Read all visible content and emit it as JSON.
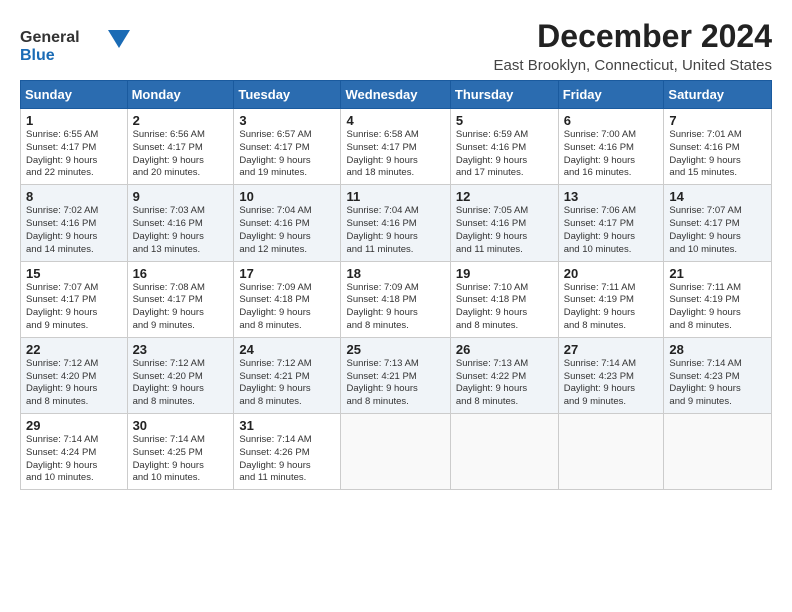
{
  "logo": {
    "line1": "General",
    "line2": "Blue"
  },
  "title": "December 2024",
  "subtitle": "East Brooklyn, Connecticut, United States",
  "header": {
    "colors": {
      "bg": "#2b6cb0"
    }
  },
  "weekdays": [
    "Sunday",
    "Monday",
    "Tuesday",
    "Wednesday",
    "Thursday",
    "Friday",
    "Saturday"
  ],
  "weeks": [
    [
      {
        "day": "1",
        "info": "Sunrise: 6:55 AM\nSunset: 4:17 PM\nDaylight: 9 hours\nand 22 minutes."
      },
      {
        "day": "2",
        "info": "Sunrise: 6:56 AM\nSunset: 4:17 PM\nDaylight: 9 hours\nand 20 minutes."
      },
      {
        "day": "3",
        "info": "Sunrise: 6:57 AM\nSunset: 4:17 PM\nDaylight: 9 hours\nand 19 minutes."
      },
      {
        "day": "4",
        "info": "Sunrise: 6:58 AM\nSunset: 4:17 PM\nDaylight: 9 hours\nand 18 minutes."
      },
      {
        "day": "5",
        "info": "Sunrise: 6:59 AM\nSunset: 4:16 PM\nDaylight: 9 hours\nand 17 minutes."
      },
      {
        "day": "6",
        "info": "Sunrise: 7:00 AM\nSunset: 4:16 PM\nDaylight: 9 hours\nand 16 minutes."
      },
      {
        "day": "7",
        "info": "Sunrise: 7:01 AM\nSunset: 4:16 PM\nDaylight: 9 hours\nand 15 minutes."
      }
    ],
    [
      {
        "day": "8",
        "info": "Sunrise: 7:02 AM\nSunset: 4:16 PM\nDaylight: 9 hours\nand 14 minutes."
      },
      {
        "day": "9",
        "info": "Sunrise: 7:03 AM\nSunset: 4:16 PM\nDaylight: 9 hours\nand 13 minutes."
      },
      {
        "day": "10",
        "info": "Sunrise: 7:04 AM\nSunset: 4:16 PM\nDaylight: 9 hours\nand 12 minutes."
      },
      {
        "day": "11",
        "info": "Sunrise: 7:04 AM\nSunset: 4:16 PM\nDaylight: 9 hours\nand 11 minutes."
      },
      {
        "day": "12",
        "info": "Sunrise: 7:05 AM\nSunset: 4:16 PM\nDaylight: 9 hours\nand 11 minutes."
      },
      {
        "day": "13",
        "info": "Sunrise: 7:06 AM\nSunset: 4:17 PM\nDaylight: 9 hours\nand 10 minutes."
      },
      {
        "day": "14",
        "info": "Sunrise: 7:07 AM\nSunset: 4:17 PM\nDaylight: 9 hours\nand 10 minutes."
      }
    ],
    [
      {
        "day": "15",
        "info": "Sunrise: 7:07 AM\nSunset: 4:17 PM\nDaylight: 9 hours\nand 9 minutes."
      },
      {
        "day": "16",
        "info": "Sunrise: 7:08 AM\nSunset: 4:17 PM\nDaylight: 9 hours\nand 9 minutes."
      },
      {
        "day": "17",
        "info": "Sunrise: 7:09 AM\nSunset: 4:18 PM\nDaylight: 9 hours\nand 8 minutes."
      },
      {
        "day": "18",
        "info": "Sunrise: 7:09 AM\nSunset: 4:18 PM\nDaylight: 9 hours\nand 8 minutes."
      },
      {
        "day": "19",
        "info": "Sunrise: 7:10 AM\nSunset: 4:18 PM\nDaylight: 9 hours\nand 8 minutes."
      },
      {
        "day": "20",
        "info": "Sunrise: 7:11 AM\nSunset: 4:19 PM\nDaylight: 9 hours\nand 8 minutes."
      },
      {
        "day": "21",
        "info": "Sunrise: 7:11 AM\nSunset: 4:19 PM\nDaylight: 9 hours\nand 8 minutes."
      }
    ],
    [
      {
        "day": "22",
        "info": "Sunrise: 7:12 AM\nSunset: 4:20 PM\nDaylight: 9 hours\nand 8 minutes."
      },
      {
        "day": "23",
        "info": "Sunrise: 7:12 AM\nSunset: 4:20 PM\nDaylight: 9 hours\nand 8 minutes."
      },
      {
        "day": "24",
        "info": "Sunrise: 7:12 AM\nSunset: 4:21 PM\nDaylight: 9 hours\nand 8 minutes."
      },
      {
        "day": "25",
        "info": "Sunrise: 7:13 AM\nSunset: 4:21 PM\nDaylight: 9 hours\nand 8 minutes."
      },
      {
        "day": "26",
        "info": "Sunrise: 7:13 AM\nSunset: 4:22 PM\nDaylight: 9 hours\nand 8 minutes."
      },
      {
        "day": "27",
        "info": "Sunrise: 7:14 AM\nSunset: 4:23 PM\nDaylight: 9 hours\nand 9 minutes."
      },
      {
        "day": "28",
        "info": "Sunrise: 7:14 AM\nSunset: 4:23 PM\nDaylight: 9 hours\nand 9 minutes."
      }
    ],
    [
      {
        "day": "29",
        "info": "Sunrise: 7:14 AM\nSunset: 4:24 PM\nDaylight: 9 hours\nand 10 minutes."
      },
      {
        "day": "30",
        "info": "Sunrise: 7:14 AM\nSunset: 4:25 PM\nDaylight: 9 hours\nand 10 minutes."
      },
      {
        "day": "31",
        "info": "Sunrise: 7:14 AM\nSunset: 4:26 PM\nDaylight: 9 hours\nand 11 minutes."
      },
      null,
      null,
      null,
      null
    ]
  ]
}
